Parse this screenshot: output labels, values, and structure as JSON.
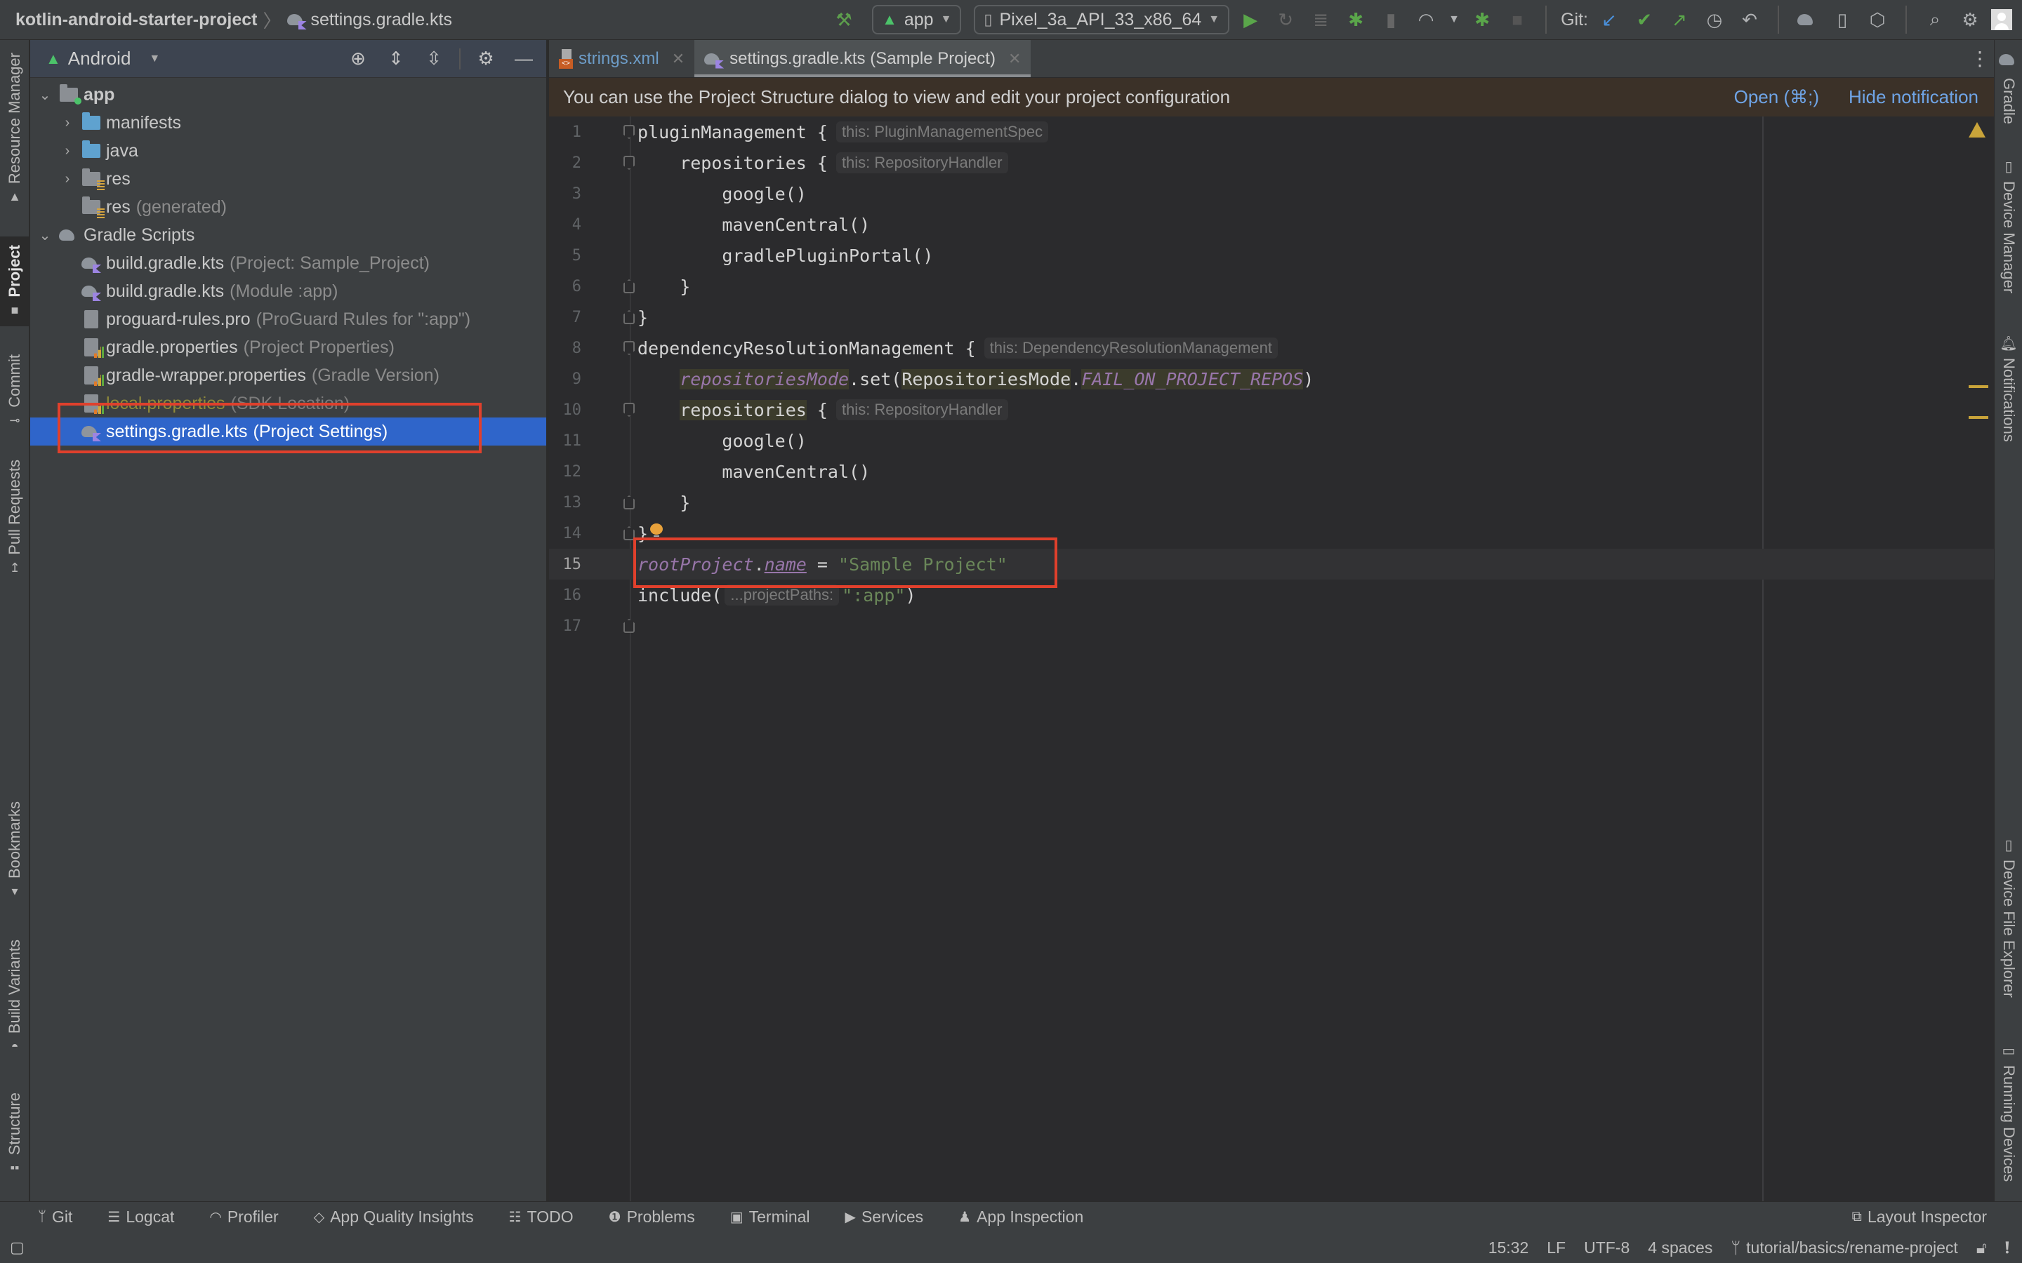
{
  "toolbar": {
    "project_name": "kotlin-android-starter-project",
    "file_name": "settings.gradle.kts",
    "run_config": "app",
    "device": "Pixel_3a_API_33_x86_64",
    "git_label": "Git:",
    "icons": [
      "hammer-icon",
      "run-icon",
      "apply-changes-icon",
      "apply-code-changes-icon",
      "debug-icon",
      "attach-debugger-icon",
      "profile-icon",
      "attach-debugger-android-icon",
      "stop-icon",
      "git-update-icon",
      "git-commit-icon",
      "git-push-icon",
      "history-icon",
      "rollback-icon",
      "gradle-sync-icon",
      "avd-manager-icon",
      "sdk-manager-icon",
      "search-icon",
      "settings-icon",
      "avatar"
    ]
  },
  "left_strip": {
    "tabs": [
      {
        "label": "Resource Manager",
        "active": false
      },
      {
        "label": "Project",
        "active": true
      },
      {
        "label": "Commit",
        "active": false
      },
      {
        "label": "Pull Requests",
        "active": false
      },
      {
        "label": "Bookmarks",
        "active": false
      },
      {
        "label": "Build Variants",
        "active": false
      },
      {
        "label": "Structure",
        "active": false
      }
    ]
  },
  "right_strip": {
    "tabs": [
      {
        "label": "Gradle"
      },
      {
        "label": "Device Manager"
      },
      {
        "label": "Notifications"
      },
      {
        "label": "Device File Explorer"
      },
      {
        "label": "Running Devices"
      }
    ]
  },
  "project_panel": {
    "view_mode": "Android",
    "tree": [
      {
        "name": "app",
        "hint": "",
        "expanded": true,
        "level": 0
      },
      {
        "name": "manifests",
        "hint": "",
        "level": 1
      },
      {
        "name": "java",
        "hint": "",
        "level": 1
      },
      {
        "name": "res",
        "hint": "",
        "level": 1
      },
      {
        "name": "res",
        "hint": "(generated)",
        "level": 1
      },
      {
        "name": "Gradle Scripts",
        "hint": "",
        "expanded": true,
        "level": 0
      },
      {
        "name": "build.gradle.kts",
        "hint": "(Project: Sample_Project)",
        "level": 1
      },
      {
        "name": "build.gradle.kts",
        "hint": "(Module :app)",
        "level": 1
      },
      {
        "name": "proguard-rules.pro",
        "hint": "(ProGuard Rules for \":app\")",
        "level": 1
      },
      {
        "name": "gradle.properties",
        "hint": "(Project Properties)",
        "level": 1
      },
      {
        "name": "gradle-wrapper.properties",
        "hint": "(Gradle Version)",
        "level": 1
      },
      {
        "name": "local.properties",
        "hint": "(SDK Location)",
        "level": 1
      },
      {
        "name": "settings.gradle.kts",
        "hint": "(Project Settings)",
        "level": 1,
        "selected": true
      }
    ]
  },
  "editor": {
    "tabs": [
      {
        "label": "strings.xml",
        "active": false
      },
      {
        "label": "settings.gradle.kts (Sample Project)",
        "active": true
      }
    ],
    "notification": {
      "message": "You can use the Project Structure dialog to view and edit your project configuration",
      "open_label": "Open (⌘;)",
      "hide_label": "Hide notification"
    },
    "lines": [
      {
        "n": "1",
        "code": "pluginManagement {",
        "inlay": "this: PluginManagementSpec"
      },
      {
        "n": "2",
        "code": "    repositories {",
        "inlay": "this: RepositoryHandler"
      },
      {
        "n": "3",
        "code": "        google()"
      },
      {
        "n": "4",
        "code": "        mavenCentral()"
      },
      {
        "n": "5",
        "code": "        gradlePluginPortal()"
      },
      {
        "n": "6",
        "code": "    }"
      },
      {
        "n": "7",
        "code": "}"
      },
      {
        "n": "8",
        "code": "dependencyResolutionManagement {",
        "inlay": "this: DependencyResolutionManagement"
      },
      {
        "n": "9",
        "parts": [
          "repositoriesMode",
          ".set(",
          "RepositoriesMode",
          ".",
          "FAIL_ON_PROJECT_REPOS",
          ")"
        ]
      },
      {
        "n": "10",
        "code": "repositories",
        "code_tail": " {",
        "inlay": "this: RepositoryHandler"
      },
      {
        "n": "11",
        "code": "        google()"
      },
      {
        "n": "12",
        "code": "        mavenCentral()"
      },
      {
        "n": "13",
        "code": "    }"
      },
      {
        "n": "14",
        "code": "}"
      },
      {
        "n": "15",
        "parts": [
          "rootProject",
          ".",
          "name",
          " = ",
          "\"Sample Project\""
        ]
      },
      {
        "n": "16",
        "parts": [
          "include(",
          "...projectPaths:",
          "\":app\"",
          ")"
        ]
      },
      {
        "n": "17",
        "code": ""
      }
    ],
    "current_line": 15
  },
  "bottom_tools": [
    {
      "label": "Git",
      "icon": "git-branch-icon"
    },
    {
      "label": "Logcat",
      "icon": "logcat-icon"
    },
    {
      "label": "Profiler",
      "icon": "profiler-icon"
    },
    {
      "label": "App Quality Insights",
      "icon": "diamond-icon"
    },
    {
      "label": "TODO",
      "icon": "todo-list-icon"
    },
    {
      "label": "Problems",
      "icon": "problems-icon"
    },
    {
      "label": "Terminal",
      "icon": "terminal-icon"
    },
    {
      "label": "Services",
      "icon": "services-icon"
    },
    {
      "label": "App Inspection",
      "icon": "app-inspection-icon"
    }
  ],
  "layout_inspector": "Layout Inspector",
  "status_bar": {
    "position": "15:32",
    "line_separator": "LF",
    "encoding": "UTF-8",
    "indent": "4 spaces",
    "branch": "tutorial/basics/rename-project"
  },
  "colors": {
    "selection": "#2f65ca",
    "highlight_box": "#e0402c",
    "link": "#6fa4e6",
    "string": "#6a8759",
    "property": "#9876aa"
  }
}
